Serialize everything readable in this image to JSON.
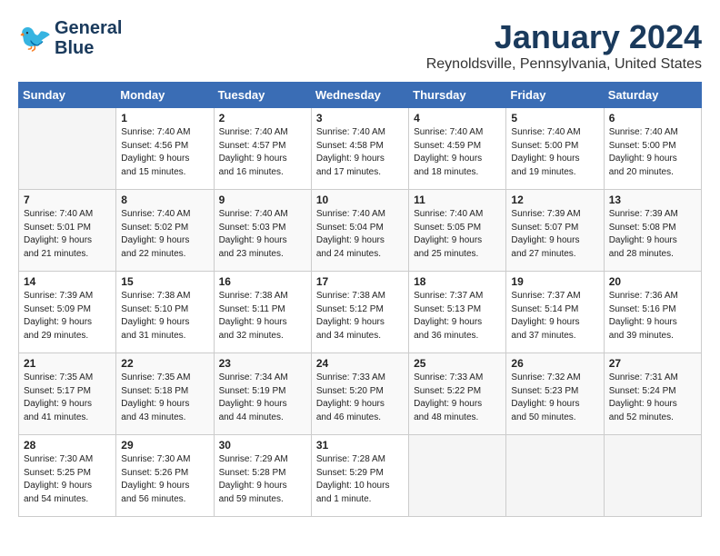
{
  "header": {
    "logo_line1": "General",
    "logo_line2": "Blue",
    "month_title": "January 2024",
    "location": "Reynoldsville, Pennsylvania, United States"
  },
  "columns": [
    "Sunday",
    "Monday",
    "Tuesday",
    "Wednesday",
    "Thursday",
    "Friday",
    "Saturday"
  ],
  "weeks": [
    [
      {
        "day": "",
        "info": ""
      },
      {
        "day": "1",
        "info": "Sunrise: 7:40 AM\nSunset: 4:56 PM\nDaylight: 9 hours\nand 15 minutes."
      },
      {
        "day": "2",
        "info": "Sunrise: 7:40 AM\nSunset: 4:57 PM\nDaylight: 9 hours\nand 16 minutes."
      },
      {
        "day": "3",
        "info": "Sunrise: 7:40 AM\nSunset: 4:58 PM\nDaylight: 9 hours\nand 17 minutes."
      },
      {
        "day": "4",
        "info": "Sunrise: 7:40 AM\nSunset: 4:59 PM\nDaylight: 9 hours\nand 18 minutes."
      },
      {
        "day": "5",
        "info": "Sunrise: 7:40 AM\nSunset: 5:00 PM\nDaylight: 9 hours\nand 19 minutes."
      },
      {
        "day": "6",
        "info": "Sunrise: 7:40 AM\nSunset: 5:00 PM\nDaylight: 9 hours\nand 20 minutes."
      }
    ],
    [
      {
        "day": "7",
        "info": "Sunrise: 7:40 AM\nSunset: 5:01 PM\nDaylight: 9 hours\nand 21 minutes."
      },
      {
        "day": "8",
        "info": "Sunrise: 7:40 AM\nSunset: 5:02 PM\nDaylight: 9 hours\nand 22 minutes."
      },
      {
        "day": "9",
        "info": "Sunrise: 7:40 AM\nSunset: 5:03 PM\nDaylight: 9 hours\nand 23 minutes."
      },
      {
        "day": "10",
        "info": "Sunrise: 7:40 AM\nSunset: 5:04 PM\nDaylight: 9 hours\nand 24 minutes."
      },
      {
        "day": "11",
        "info": "Sunrise: 7:40 AM\nSunset: 5:05 PM\nDaylight: 9 hours\nand 25 minutes."
      },
      {
        "day": "12",
        "info": "Sunrise: 7:39 AM\nSunset: 5:07 PM\nDaylight: 9 hours\nand 27 minutes."
      },
      {
        "day": "13",
        "info": "Sunrise: 7:39 AM\nSunset: 5:08 PM\nDaylight: 9 hours\nand 28 minutes."
      }
    ],
    [
      {
        "day": "14",
        "info": "Sunrise: 7:39 AM\nSunset: 5:09 PM\nDaylight: 9 hours\nand 29 minutes."
      },
      {
        "day": "15",
        "info": "Sunrise: 7:38 AM\nSunset: 5:10 PM\nDaylight: 9 hours\nand 31 minutes."
      },
      {
        "day": "16",
        "info": "Sunrise: 7:38 AM\nSunset: 5:11 PM\nDaylight: 9 hours\nand 32 minutes."
      },
      {
        "day": "17",
        "info": "Sunrise: 7:38 AM\nSunset: 5:12 PM\nDaylight: 9 hours\nand 34 minutes."
      },
      {
        "day": "18",
        "info": "Sunrise: 7:37 AM\nSunset: 5:13 PM\nDaylight: 9 hours\nand 36 minutes."
      },
      {
        "day": "19",
        "info": "Sunrise: 7:37 AM\nSunset: 5:14 PM\nDaylight: 9 hours\nand 37 minutes."
      },
      {
        "day": "20",
        "info": "Sunrise: 7:36 AM\nSunset: 5:16 PM\nDaylight: 9 hours\nand 39 minutes."
      }
    ],
    [
      {
        "day": "21",
        "info": "Sunrise: 7:35 AM\nSunset: 5:17 PM\nDaylight: 9 hours\nand 41 minutes."
      },
      {
        "day": "22",
        "info": "Sunrise: 7:35 AM\nSunset: 5:18 PM\nDaylight: 9 hours\nand 43 minutes."
      },
      {
        "day": "23",
        "info": "Sunrise: 7:34 AM\nSunset: 5:19 PM\nDaylight: 9 hours\nand 44 minutes."
      },
      {
        "day": "24",
        "info": "Sunrise: 7:33 AM\nSunset: 5:20 PM\nDaylight: 9 hours\nand 46 minutes."
      },
      {
        "day": "25",
        "info": "Sunrise: 7:33 AM\nSunset: 5:22 PM\nDaylight: 9 hours\nand 48 minutes."
      },
      {
        "day": "26",
        "info": "Sunrise: 7:32 AM\nSunset: 5:23 PM\nDaylight: 9 hours\nand 50 minutes."
      },
      {
        "day": "27",
        "info": "Sunrise: 7:31 AM\nSunset: 5:24 PM\nDaylight: 9 hours\nand 52 minutes."
      }
    ],
    [
      {
        "day": "28",
        "info": "Sunrise: 7:30 AM\nSunset: 5:25 PM\nDaylight: 9 hours\nand 54 minutes."
      },
      {
        "day": "29",
        "info": "Sunrise: 7:30 AM\nSunset: 5:26 PM\nDaylight: 9 hours\nand 56 minutes."
      },
      {
        "day": "30",
        "info": "Sunrise: 7:29 AM\nSunset: 5:28 PM\nDaylight: 9 hours\nand 59 minutes."
      },
      {
        "day": "31",
        "info": "Sunrise: 7:28 AM\nSunset: 5:29 PM\nDaylight: 10 hours\nand 1 minute."
      },
      {
        "day": "",
        "info": ""
      },
      {
        "day": "",
        "info": ""
      },
      {
        "day": "",
        "info": ""
      }
    ]
  ]
}
